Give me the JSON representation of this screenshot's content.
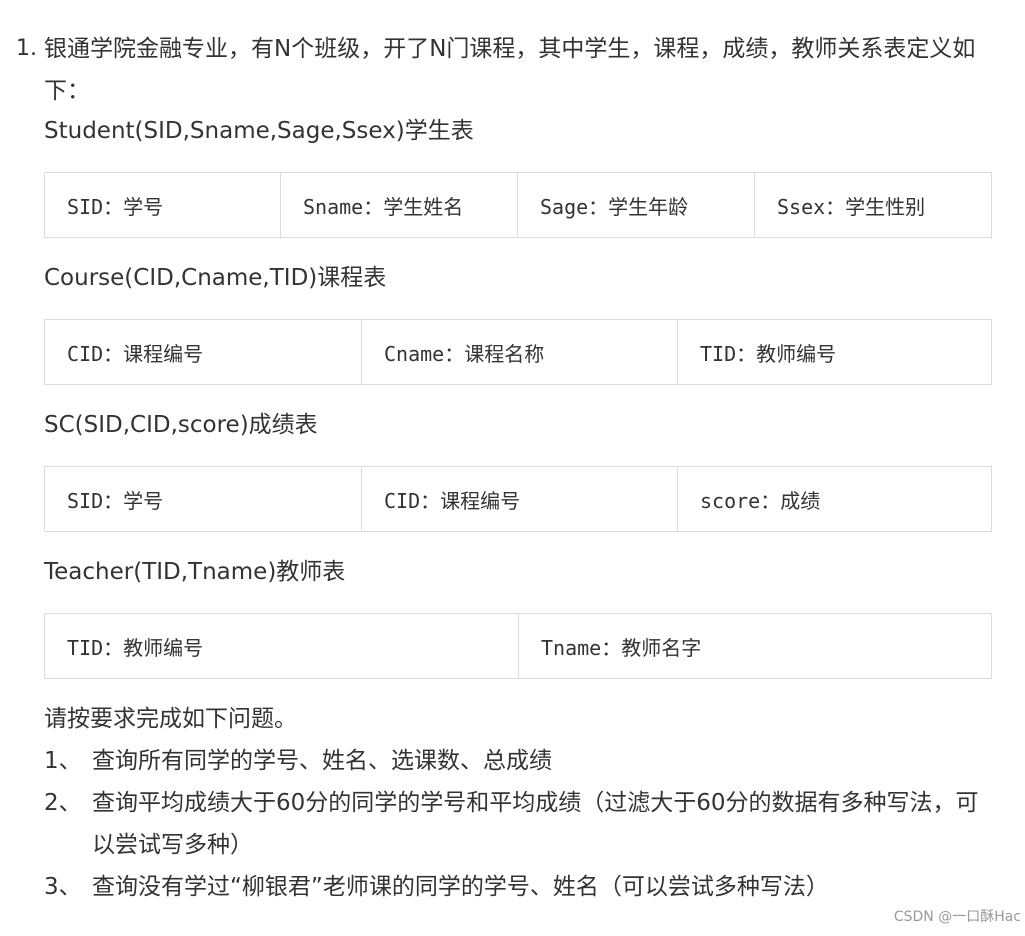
{
  "intro": {
    "number": "1.",
    "text": "银通学院金融专业，有N个班级，开了N门课程，其中学生，课程，成绩，教师关系表定义如下："
  },
  "schemas": [
    {
      "title": "Student(SID,Sname,Sage,Ssex)学生表",
      "columns": [
        "SID：学号",
        "Sname：学生姓名",
        "Sage：学生年龄",
        "Ssex：学生性别"
      ]
    },
    {
      "title": "Course(CID,Cname,TID)课程表",
      "columns": [
        "CID：课程编号",
        "Cname：课程名称",
        "TID：教师编号"
      ]
    },
    {
      "title": "SC(SID,CID,score)成绩表",
      "columns": [
        "SID：学号",
        "CID：课程编号",
        "score：成绩"
      ]
    },
    {
      "title": "Teacher(TID,Tname)教师表",
      "columns": [
        "TID：教师编号",
        "Tname：教师名字"
      ]
    }
  ],
  "tasks": {
    "heading": "请按要求完成如下问题。",
    "items": [
      {
        "number": "1、",
        "text": "查询所有同学的学号、姓名、选课数、总成绩"
      },
      {
        "number": "2、",
        "text": "查询平均成绩大于60分的同学的学号和平均成绩（过滤大于60分的数据有多种写法，可以尝试写多种）"
      },
      {
        "number": "3、",
        "text": "查询没有学过“柳银君”老师课的同学的学号、姓名（可以尝试多种写法）"
      }
    ]
  },
  "watermark": "CSDN @一口酥Hac"
}
